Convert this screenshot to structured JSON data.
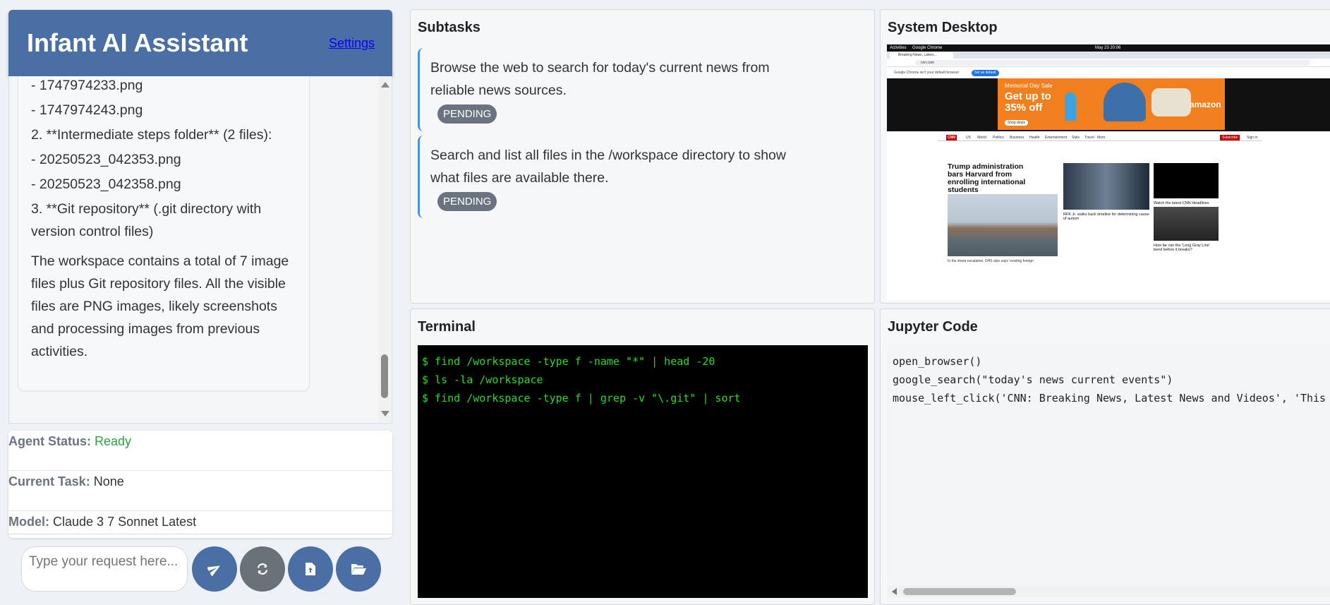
{
  "header": {
    "title": "Infant AI Assistant",
    "settings_label": "Settings"
  },
  "chat": {
    "lines": [
      "- 1747974233.png",
      "- 1747974243.png",
      "2. **Intermediate steps folder** (2 files):",
      "- 20250523_042353.png",
      "- 20250523_042358.png",
      "3. **Git repository** (.git directory with version control files)",
      "The workspace contains a total of 7 image files plus Git repository files. All the visible files are PNG images, likely screenshots and processing images from previous activities."
    ]
  },
  "status": {
    "agent_status_label": "Agent Status:",
    "agent_status_value": "Ready",
    "current_task_label": "Current Task:",
    "current_task_value": "None",
    "model_label": "Model:",
    "model_value": "Claude 3 7 Sonnet Latest"
  },
  "input": {
    "placeholder": "Type your request here..."
  },
  "icons": {
    "send": "send-icon",
    "refresh": "refresh-icon",
    "file": "file-icon",
    "folder": "folder-open-icon"
  },
  "subtasks": {
    "title": "Subtasks",
    "items": [
      {
        "text": "Browse the web to search for today's current news from reliable news sources.",
        "status": "PENDING"
      },
      {
        "text": "Search and list all files in the /workspace directory to show what files are available there.",
        "status": "PENDING"
      }
    ]
  },
  "desktop": {
    "title": "System Desktop",
    "screenshot": {
      "topbar_left": "Activities",
      "topbar_app": "Google Chrome",
      "topbar_date": "May 23 20:06",
      "tab_label": "Breaking News, Latest...",
      "url": "cnn.com",
      "notice": "Google Chrome isn't your default browser",
      "notice_button": "Set as default",
      "ad_title": "Memorial Day Sale",
      "ad_offer": "Get up to 35% off",
      "ad_brand": "amazon",
      "ad_cta": "Shop deals",
      "nav_brand": "CNN",
      "nav_items": [
        "US",
        "World",
        "Politics",
        "Business",
        "Health",
        "Entertainment",
        "Style",
        "Travel",
        "More"
      ],
      "subscribe": "Subscribe",
      "sign_in": "Sign in",
      "headline": "Trump administration bars Harvard from enrolling international students",
      "headline_sub": "In the sharp escalation, DHS also says 'existing foreign",
      "story2": "RFK Jr. walks back timeline for determining cause of autism",
      "story3": "Watch the latest CNN Headlines",
      "story4": "How far can the 'Long Gray Line' bend before it breaks?"
    }
  },
  "terminal": {
    "title": "Terminal",
    "lines": [
      "$ find /workspace -type f -name \"*\" | head -20",
      "$ ls -la /workspace",
      "$ find /workspace -type f | grep -v \"\\.git\" | sort"
    ]
  },
  "jupyter": {
    "title": "Jupyter Code",
    "lines": [
      "open_browser()",
      "google_search(\"today's news current events\")",
      "mouse_left_click('CNN: Breaking News, Latest News and Videos', 'This i"
    ]
  },
  "colors": {
    "header": "#4a6fa5",
    "ready": "#2ea043",
    "badge": "#6b7280",
    "terminal_text": "#22dd22"
  }
}
